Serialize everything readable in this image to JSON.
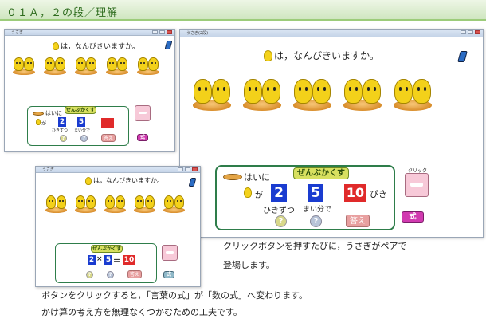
{
  "header": {
    "title": "０１Ａ，２の段／理解"
  },
  "question": "は，なんびきいますか。",
  "window_titles": {
    "small": "うさぎ",
    "large": "うさぎ(2段)"
  },
  "box": {
    "label": "ぜんぶかくす",
    "hai_ni": "はいに",
    "ga": "が",
    "num1": "2",
    "num2": "5",
    "num3": "10",
    "hikizutsu": "ひきずつ",
    "maibunde": "まい分で",
    "hiki": "ぴき",
    "q1": "?",
    "q2": "?",
    "answer": "答え",
    "click": "クリック",
    "shiki": "式"
  },
  "math": {
    "a": "2",
    "op": "×",
    "b": "5",
    "eq": "＝",
    "c": "10"
  },
  "captions": {
    "line1": "クリックボタンを押すたびに，うさぎがペアで",
    "line2": "登場します。",
    "line3": "ボタンをクリックすると，「言葉の式」が「数の式」へ変わります。",
    "line4": "かけ算の考え方を無理なくつかむための工夫です。"
  },
  "colors": {
    "accent": "#2e7d4a",
    "num_blue": "#1a3cd0",
    "num_red": "#e02a2a",
    "header_green": "#2d6b1d"
  }
}
